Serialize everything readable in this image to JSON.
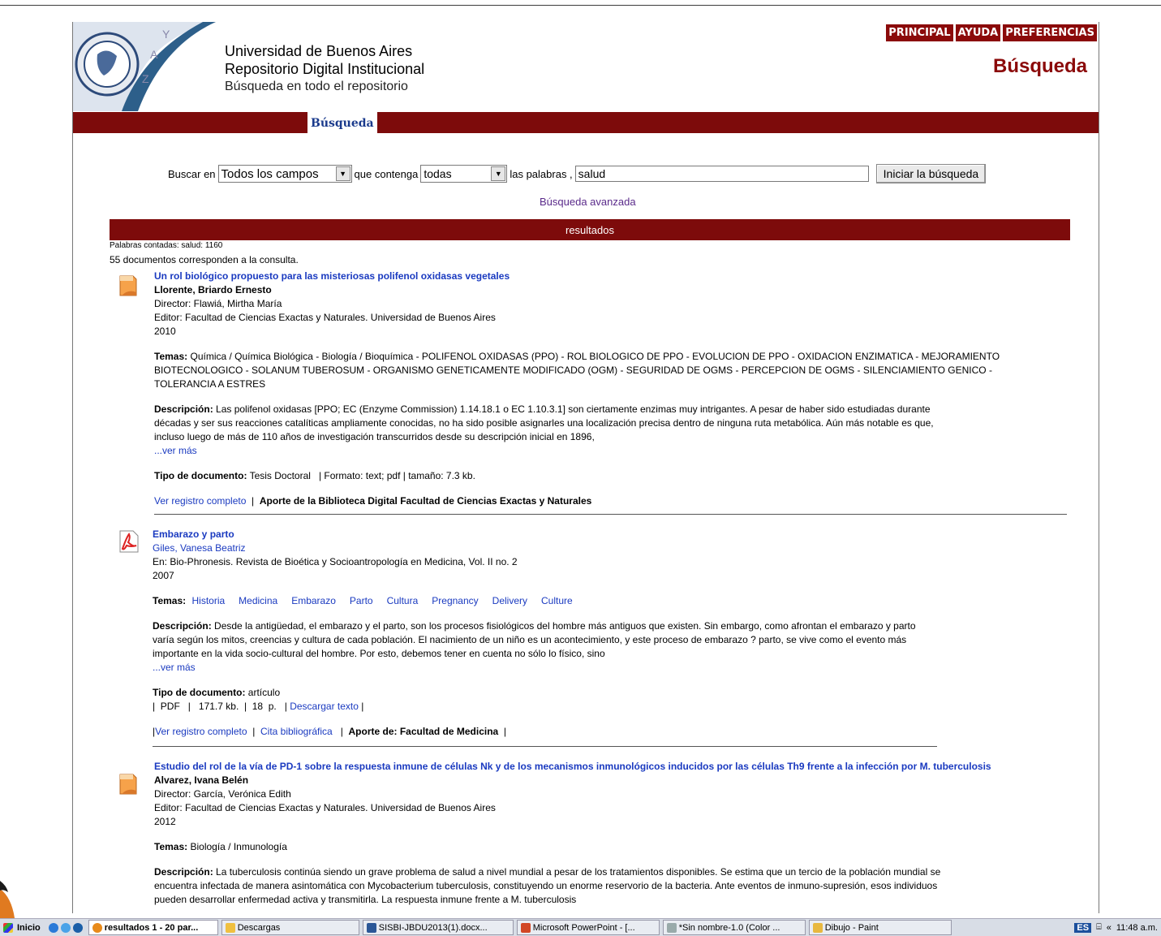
{
  "header": {
    "university": "Universidad de Buenos Aires",
    "repository": "Repositorio Digital Institucional",
    "subtitle": "Búsqueda en todo el repositorio",
    "nav": [
      "PRINCIPAL",
      "AYUDA",
      "PREFERENCIAS"
    ],
    "page_title": "Búsqueda",
    "tab": "Búsqueda"
  },
  "search": {
    "label_in": "Buscar en",
    "field": "Todos los campos",
    "label_contains": "que contenga",
    "mode": "todas",
    "label_words": "las palabras ,",
    "query": "salud",
    "submit": "Iniciar la búsqueda",
    "advanced": "Búsqueda avanzada"
  },
  "results": {
    "bar": "resultados",
    "word_counts": "Palabras contadas: salud: 1160",
    "total": "55 documentos corresponden a la consulta."
  },
  "records": [
    {
      "title": "Un rol biológico propuesto para las misteriosas polifenol oxidasas vegetales",
      "author": "Llorente, Briardo Ernesto",
      "director": "Director: Flawiá, Mirtha María",
      "editor": "Editor: Facultad de Ciencias Exactas y Naturales. Universidad de Buenos Aires",
      "year": "2010",
      "temas_label": "Temas:",
      "temas": "Química / Química Biológica - Biología / Bioquímica - POLIFENOL OXIDASAS (PPO) - ROL BIOLOGICO DE PPO - EVOLUCION DE PPO - OXIDACION ENZIMATICA - MEJORAMIENTO BIOTECNOLOGICO - SOLANUM TUBEROSUM - ORGANISMO GENETICAMENTE MODIFICADO (OGM) - SEGURIDAD DE OGMS - PERCEPCION DE OGMS - SILENCIAMIENTO GENICO - TOLERANCIA A ESTRES",
      "desc_label": "Descripción:",
      "desc": "Las polifenol oxidasas [PPO; EC (Enzyme Commission) 1.14.18.1 o EC 1.10.3.1] son ciertamente enzimas muy intrigantes. A pesar de haber sido estudiadas durante décadas y ser sus reacciones catalíticas ampliamente conocidas, no ha sido posible asignarles una localización precisa dentro de ninguna ruta metabólica. Aún más notable es que, incluso luego de más de 110 años de investigación transcurridos desde su descripción inicial en 1896,",
      "more": "...ver más",
      "tipo_label": "Tipo de documento:",
      "tipo": "Tesis Doctoral",
      "formato": "|   Formato: text; pdf  |   tamaño: 7.3 kb.",
      "ver": "Ver registro completo",
      "sep": "  |  ",
      "aporte": "Aporte de la Biblioteca Digital Facultad de Ciencias Exactas y Naturales"
    },
    {
      "title": "Embarazo y parto",
      "author": "Giles, Vanesa Beatriz",
      "editor": "En: Bio-Phronesis. Revista de Bioética y Socioantropología en Medicina, Vol. II no. 2",
      "year": "2007",
      "temas_label": "Temas:",
      "temas": [
        "Historia",
        "Medicina",
        "Embarazo",
        "Parto",
        "Cultura",
        "Pregnancy",
        "Delivery",
        "Culture"
      ],
      "desc_label": "Descripción:",
      "desc": "Desde la antigüedad, el embarazo y el parto, son los procesos fisiológicos del hombre más antiguos que existen. Sin embargo, como afrontan el embarazo y parto varía según los mitos, creencias y cultura de cada población. El nacimiento de un niño es un acontecimiento, y este proceso de embarazo ? parto, se vive como el evento más importante en la vida socio-cultural del hombre. Por esto, debemos tener en cuenta no sólo lo físico, sino",
      "more": "...ver más",
      "tipo_label": "Tipo de documento:",
      "tipo": "artículo",
      "formato": "|  PDF   |   171.7 kb.  |  18  p.   |",
      "descargar": "Descargar texto",
      "pipe": "|",
      "ver": "Ver registro completo",
      "cita": "Cita bibliográfica",
      "aporte": "Aporte de: Facultad de Medicina"
    },
    {
      "title": "Estudio del rol de la vía de PD-1 sobre la respuesta inmune de células Nk y de los mecanismos inmunológicos inducidos por las células Th9 frente a la infección por M. tuberculosis",
      "author": "Alvarez, Ivana Belén",
      "director": "Director: García, Verónica Edith",
      "editor": "Editor: Facultad de Ciencias Exactas y Naturales. Universidad de Buenos Aires",
      "year": "2012",
      "temas_label": "Temas:",
      "temas": "Biología / Inmunología",
      "desc_label": "Descripción:",
      "desc": "La tuberculosis continúa siendo un grave problema de salud a nivel mundial a pesar de los tratamientos disponibles. Se estima que un tercio de la población mundial se encuentra infectada de manera asintomática con Mycobacterium tuberculosis, constituyendo un enorme reservorio de la bacteria. Ante eventos de inmuno-supresión, esos individuos pueden desarrollar enfermedad activa y transmitirla. La respuesta inmune frente a M. tuberculosis"
    }
  ],
  "taskbar": {
    "start": "Inicio",
    "items": [
      "resultados 1 - 20 par...",
      "Descargas",
      "SISBI-JBDU2013(1).docx...",
      "Microsoft PowerPoint - [...",
      "*Sin nombre-1.0 (Color ...",
      "Dibujo - Paint"
    ],
    "lang": "ES",
    "clock": "11:48 a.m."
  },
  "colors": {
    "brand": "#7d0b0b",
    "link": "#1428c8"
  }
}
